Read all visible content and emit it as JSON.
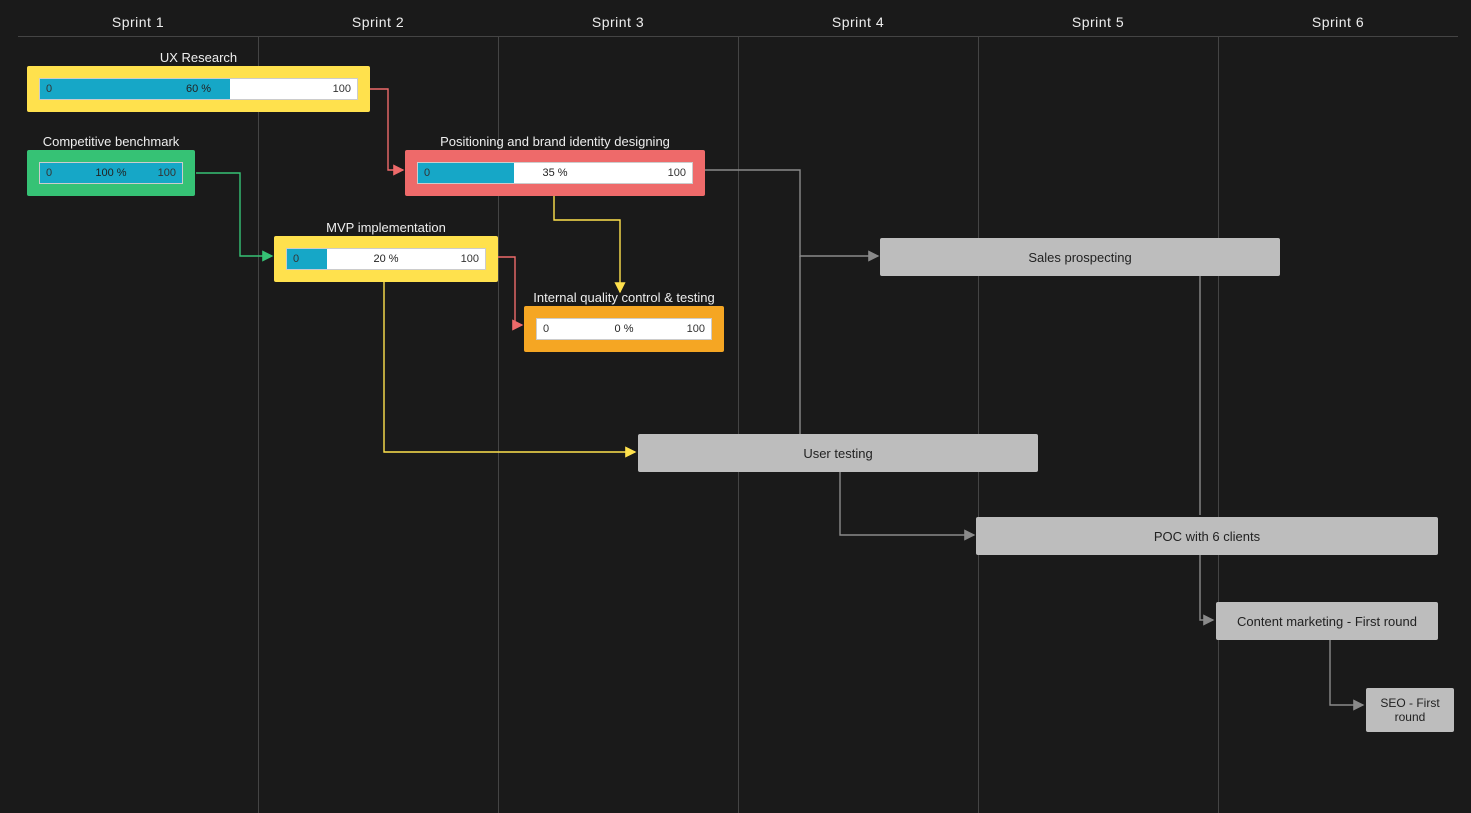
{
  "sprints": [
    "Sprint 1",
    "Sprint 2",
    "Sprint 3",
    "Sprint 4",
    "Sprint 5",
    "Sprint 6"
  ],
  "tasks": {
    "ux_research": {
      "title": "UX Research",
      "min": "0",
      "max": "100",
      "pct": "60 %",
      "fill": 60
    },
    "competitive_benchmark": {
      "title": "Competitive benchmark",
      "min": "0",
      "max": "100",
      "pct": "100 %",
      "fill": 100
    },
    "positioning": {
      "title": "Positioning and brand identity designing",
      "min": "0",
      "max": "100",
      "pct": "35 %",
      "fill": 35
    },
    "mvp": {
      "title": "MVP implementation",
      "min": "0",
      "max": "100",
      "pct": "20 %",
      "fill": 20
    },
    "internal_qc": {
      "title": "Internal quality control & testing",
      "min": "0",
      "max": "100",
      "pct": "0 %",
      "fill": 0
    },
    "user_testing": {
      "title": "User testing"
    },
    "sales_prospecting": {
      "title": "Sales prospecting"
    },
    "poc": {
      "title": "POC with 6 clients"
    },
    "content_marketing": {
      "title": "Content marketing - First round"
    },
    "seo": {
      "title": "SEO - First round"
    }
  },
  "colors": {
    "green_stroke": "#36c275",
    "yellow_stroke": "#ffe14d",
    "red_stroke": "#ee6a6a",
    "gray_stroke": "#8a8a8a"
  }
}
